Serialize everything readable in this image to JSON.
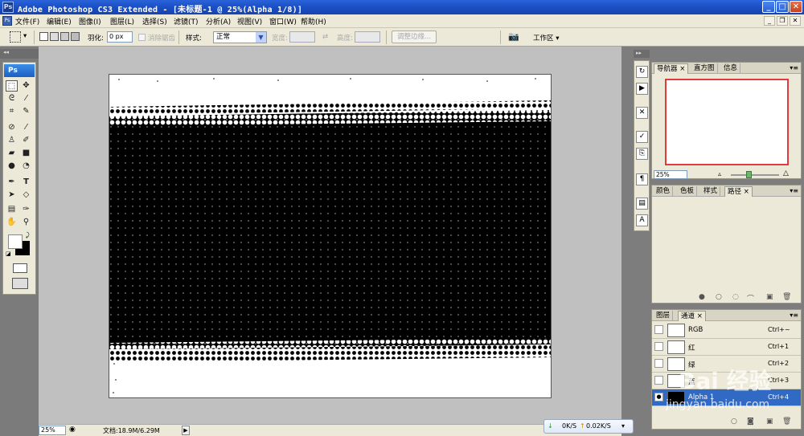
{
  "window": {
    "title": "Adobe Photoshop CS3 Extended - [未标题-1 @ 25%(Alpha 1/8)]",
    "app_icon": "Ps"
  },
  "menu": {
    "items": [
      "文件(F)",
      "编辑(E)",
      "图像(I)",
      "图层(L)",
      "选择(S)",
      "滤镜(T)",
      "分析(A)",
      "视图(V)",
      "窗口(W)",
      "帮助(H)"
    ]
  },
  "options": {
    "feather_label": "羽化:",
    "feather_value": "0 px",
    "antialias_label": "消除锯齿",
    "style_label": "样式:",
    "style_value": "正常",
    "width_label": "宽度:",
    "height_label": "高度:",
    "refine_edge": "调整边缘...",
    "workspace": "工作区 ▾"
  },
  "toolbox": {
    "logo": "Ps",
    "tools": [
      "marquee-icon",
      "move-icon",
      "lasso-icon",
      "magic-wand-icon",
      "crop-icon",
      "slice-icon",
      "healing-icon",
      "brush-icon",
      "stamp-icon",
      "history-brush-icon",
      "eraser-icon",
      "gradient-icon",
      "blur-icon",
      "dodge-icon",
      "pen-icon",
      "type-icon",
      "path-select-icon",
      "shape-icon",
      "notes-icon",
      "eyedropper-icon",
      "hand-icon",
      "zoom-icon"
    ]
  },
  "status": {
    "zoom": "25%",
    "doc_size": "文档:18.9M/6.29M"
  },
  "navigator": {
    "tabs": [
      "导航器",
      "直方图",
      "信息"
    ],
    "zoom": "25%"
  },
  "color_panel": {
    "tabs": [
      "颜色",
      "色板",
      "样式",
      "路径"
    ]
  },
  "channels": {
    "tabs": [
      "图层",
      "通道"
    ],
    "rows": [
      {
        "name": "RGB",
        "key": "Ctrl+~",
        "thumb": "#ffffff"
      },
      {
        "name": "红",
        "key": "Ctrl+1",
        "thumb": "#ffffff"
      },
      {
        "name": "绿",
        "key": "Ctrl+2",
        "thumb": "#ffffff"
      },
      {
        "name": "蓝",
        "key": "Ctrl+3",
        "thumb": "#ffffff"
      },
      {
        "name": "Alpha 1",
        "key": "Ctrl+4",
        "thumb": "#000000"
      }
    ]
  },
  "transfer": {
    "down": "0K/S",
    "up": "0.02K/S"
  },
  "watermark": {
    "text": "Bai 经验",
    "url": "jingyan.baidu.com"
  },
  "colors": {
    "title_bar": "#1a4fc4",
    "selection": "#316ac5",
    "navigator_frame": "#e03c3c"
  }
}
